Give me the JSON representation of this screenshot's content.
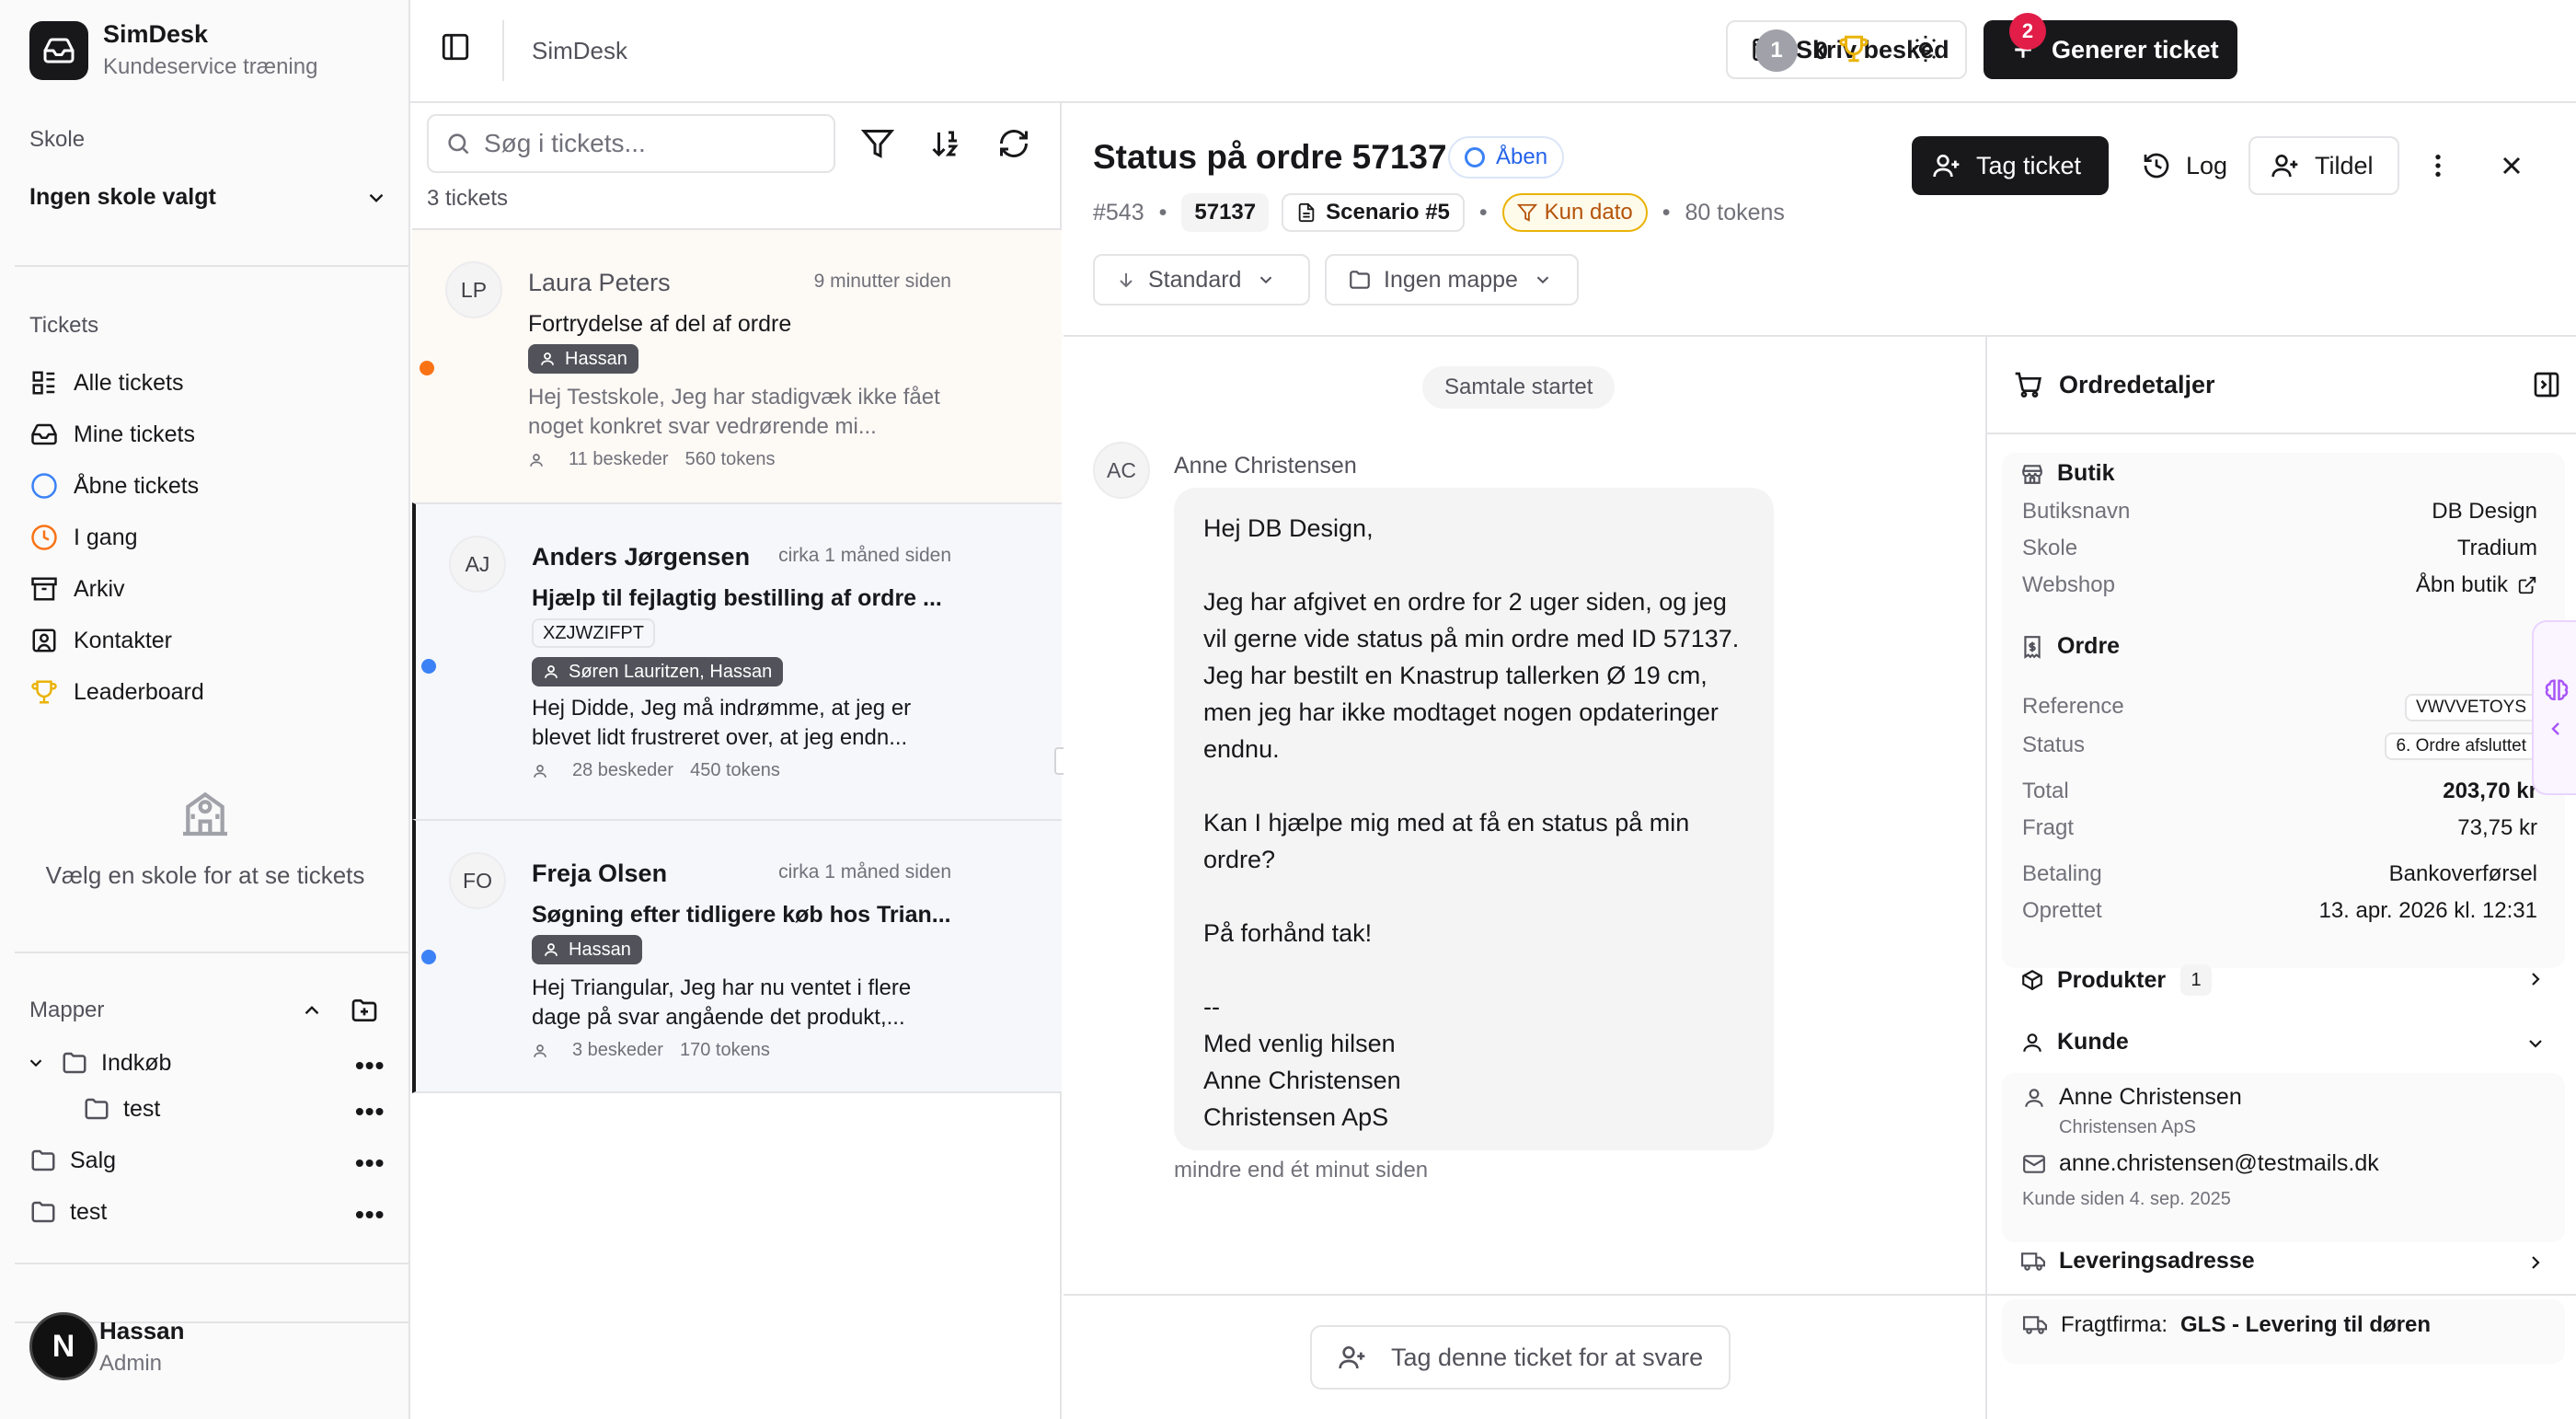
{
  "app": {
    "name": "SimDesk",
    "subtitle": "Kundeservice træning"
  },
  "sidebar": {
    "school_label": "Skole",
    "school_value": "Ingen skole valgt",
    "tickets_label": "Tickets",
    "nav": [
      {
        "label": "Alle tickets",
        "icon": "list-icon"
      },
      {
        "label": "Mine tickets",
        "icon": "inbox-icon"
      },
      {
        "label": "Åbne tickets",
        "icon": "circle-icon"
      },
      {
        "label": "I gang",
        "icon": "clock-icon"
      },
      {
        "label": "Arkiv",
        "icon": "archive-icon"
      },
      {
        "label": "Kontakter",
        "icon": "contacts-icon"
      },
      {
        "label": "Leaderboard",
        "icon": "trophy-icon"
      }
    ],
    "empty_text": "Vælg en skole for at se tickets",
    "folders_label": "Mapper",
    "folders": [
      {
        "name": "Indkøb"
      },
      {
        "name": "test"
      },
      {
        "name": "Salg"
      },
      {
        "name": "test"
      }
    ],
    "user": {
      "name": "Hassan",
      "role": "Admin",
      "initial": "N"
    }
  },
  "topbar": {
    "breadcrumb": "SimDesk",
    "write_message": "Skriv besked",
    "generate_ticket": "Generer ticket",
    "level": "1",
    "points": "0",
    "notifications": "2"
  },
  "list": {
    "search_placeholder": "Søg i tickets...",
    "count": "3 tickets",
    "tickets": [
      {
        "initials": "LP",
        "name": "Laura Peters",
        "time": "9 minutter siden",
        "subject": "Fortrydelse af del af ordre",
        "assignee": "Hassan",
        "preview": "Hej Testskole, Jeg har stadigvæk ikke fået noget konkret svar vedrørende mi...",
        "messages": "11 beskeder",
        "tokens": "560 tokens",
        "dot_color": "#f97316"
      },
      {
        "initials": "AJ",
        "name": "Anders Jørgensen",
        "time": "cirka 1 måned siden",
        "subject": "Hjælp til fejlagtig bestilling af ordre ...",
        "code": "XZJWZIFPT",
        "assignee": "Søren Lauritzen, Hassan",
        "preview": "Hej Didde, Jeg må indrømme, at jeg er blevet lidt frustreret over, at jeg endn...",
        "messages": "28 beskeder",
        "tokens": "450 tokens",
        "dot_color": "#3b82f6"
      },
      {
        "initials": "FO",
        "name": "Freja Olsen",
        "time": "cirka 1 måned siden",
        "subject": "Søgning efter tidligere køb hos Trian...",
        "assignee": "Hassan",
        "preview": "Hej Triangular, Jeg har nu ventet i flere dage på svar angående det produkt,...",
        "messages": "3 beskeder",
        "tokens": "170 tokens",
        "dot_color": "#3b82f6"
      }
    ]
  },
  "ticket": {
    "title": "Status på ordre 57137",
    "status": "Åben",
    "number": "#543",
    "order_chip": "57137",
    "scenario": "Scenario #5",
    "date_filter": "Kun dato",
    "tokens": "80 tokens",
    "priority": "Standard",
    "folder": "Ingen mappe",
    "take_label": "Tag ticket",
    "log_label": "Log",
    "assign_label": "Tildel"
  },
  "conversation": {
    "started": "Samtale startet",
    "author_initials": "AC",
    "author": "Anne Christensen",
    "body": "Hej DB Design,\n\nJeg har afgivet en ordre for 2 uger siden, og jeg vil gerne vide status på min ordre med ID 57137. Jeg har bestilt en Knastrup tallerken Ø 19 cm, men jeg har ikke modtaget nogen opdateringer endnu.\n\nKan I hjælpe mig med at få en status på min ordre?\n\nPå forhånd tak!\n\n--\nMed venlig hilsen\nAnne Christensen\nChristensen ApS",
    "time": "mindre end ét minut siden",
    "reply_button": "Tag denne ticket for at svare"
  },
  "order": {
    "title": "Ordredetaljer",
    "shop_title": "Butik",
    "shop": [
      {
        "k": "Butiksnavn",
        "v": "DB Design"
      },
      {
        "k": "Skole",
        "v": "Tradium"
      },
      {
        "k": "Webshop",
        "v": "Åbn butik"
      }
    ],
    "order_title": "Ordre",
    "reference_label": "Reference",
    "reference": "VWVVETOYS",
    "status_label": "Status",
    "status": "6. Ordre afsluttet",
    "total_label": "Total",
    "total": "203,70 kr",
    "freight_label": "Fragt",
    "freight": "73,75 kr",
    "payment_label": "Betaling",
    "payment": "Bankoverførsel",
    "created_label": "Oprettet",
    "created": "13. apr. 2026 kl. 12:31",
    "products_title": "Produkter",
    "products_count": "1",
    "customer_title": "Kunde",
    "customer_name": "Anne Christensen",
    "customer_company": "Christensen ApS",
    "customer_email": "anne.christensen@testmails.dk",
    "customer_since": "Kunde siden 4. sep. 2025",
    "delivery_title": "Leveringsadresse",
    "carrier_label": "Fragtfirma:",
    "carrier": "GLS - Levering til døren"
  }
}
